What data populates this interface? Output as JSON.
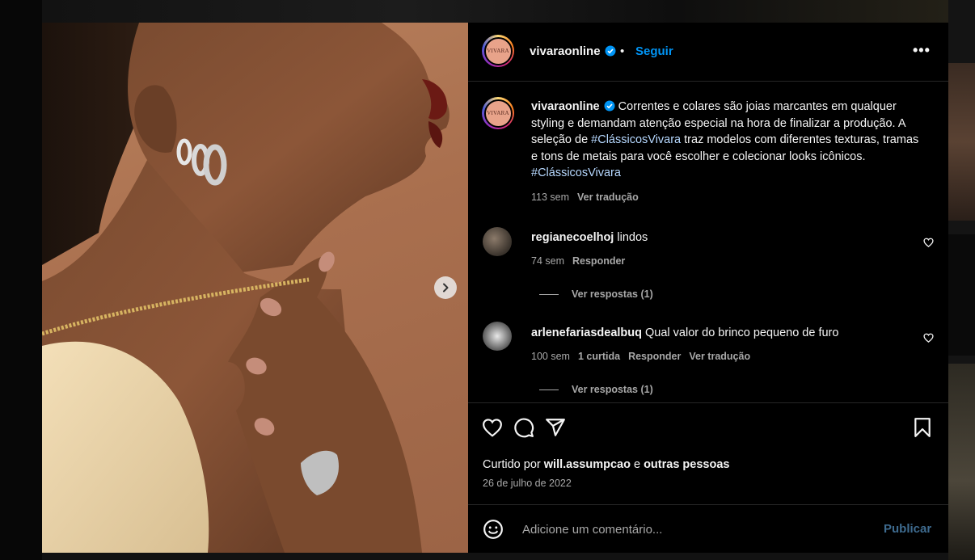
{
  "post": {
    "author": "vivaraonline",
    "follow_label": "Seguir",
    "separator": "•",
    "more_label": "•••",
    "avatar_text": "VIVARA",
    "image_dots": 3,
    "active_dot": 0
  },
  "caption": {
    "username": "vivaraonline",
    "text_before_tag": " Correntes e colares são joias marcantes em qualquer styling e demandam atenção especial na hora de finalizar a produção. A seleção de ",
    "hashtag_1": "#ClássicosVivara",
    "text_after_tag": " traz modelos com diferentes texturas, tramas e tons de metais para você escolher e colecionar looks icônicos. ",
    "hashtag_2": "#ClássicosVivara",
    "age": "113 sem",
    "translate_label": "Ver tradução"
  },
  "comments": [
    {
      "username": "regianecoelhoj",
      "text": " lindos",
      "age": "74 sem",
      "reply_label": "Responder",
      "view_replies": "Ver respostas (1)"
    },
    {
      "username": "arlenefariasdealbuq",
      "text": " Qual valor do brinco pequeno de furo",
      "age": "100 sem",
      "likes": "1 curtida",
      "reply_label": "Responder",
      "translate_label": "Ver tradução",
      "view_replies": "Ver respostas (1)"
    }
  ],
  "engagement": {
    "liked_by_prefix": "Curtido por ",
    "liked_by_user": "will.assumpcao",
    "liked_by_mid": " e ",
    "liked_by_others": "outras pessoas",
    "date": "26 de julho de 2022"
  },
  "comment_box": {
    "placeholder": "Adicione um comentário...",
    "publish_label": "Publicar"
  },
  "colors": {
    "accent_blue": "#0095f6",
    "publish_disabled": "#3e6b8f",
    "muted_text": "#a8a8a8",
    "divider": "#262626"
  },
  "icons": [
    "verified-badge-icon",
    "heart-icon",
    "comment-icon",
    "share-icon",
    "bookmark-icon",
    "emoji-icon",
    "chevron-right-icon",
    "more-icon"
  ]
}
